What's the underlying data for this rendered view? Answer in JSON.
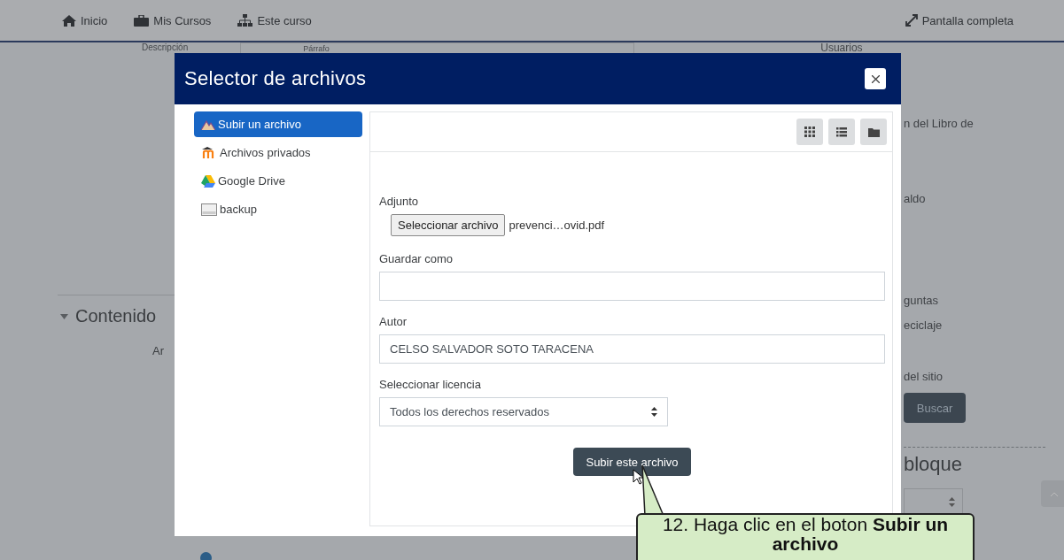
{
  "nav": {
    "items": [
      {
        "label": "Inicio",
        "kind": "home"
      },
      {
        "label": "Mis Cursos",
        "kind": "courses"
      },
      {
        "label": "Este curso",
        "kind": "course"
      }
    ],
    "fullscreen": "Pantalla completa"
  },
  "background": {
    "description_label": "Descripción",
    "format_select": "Párrafo",
    "users_link": "Usuarios",
    "section_heading": "Contenido",
    "section_text": "Ar",
    "right_items": [
      "n del Libro de",
      "aldo",
      "guntas",
      "eciclaje",
      "del sitio"
    ],
    "search_button": "Buscar",
    "block_heading": "bloque"
  },
  "dialog": {
    "title": "Selector de archivos",
    "repositories": [
      {
        "label": "Subir un archivo",
        "kind": "upload",
        "selected": true
      },
      {
        "label": "Archivos privados",
        "kind": "private",
        "selected": false
      },
      {
        "label": "Google Drive",
        "kind": "drive",
        "selected": false
      },
      {
        "label": "backup",
        "kind": "disk",
        "selected": false
      }
    ],
    "view_buttons": [
      {
        "kind": "grid"
      },
      {
        "kind": "list"
      },
      {
        "kind": "folder"
      }
    ],
    "form": {
      "attachment_label": "Adjunto",
      "choose_button": "Seleccionar archivo",
      "file_name": "prevenci…ovid.pdf",
      "save_as_label": "Guardar como",
      "author_label": "Autor",
      "author_value": "CELSO SALVADOR SOTO TARACENA",
      "license_label": "Seleccionar licencia",
      "license_value": "Todos los derechos reservados",
      "submit_button": "Subir este archivo"
    }
  },
  "callout": "12. Haga clic en el boton **Subir un archivo**"
}
